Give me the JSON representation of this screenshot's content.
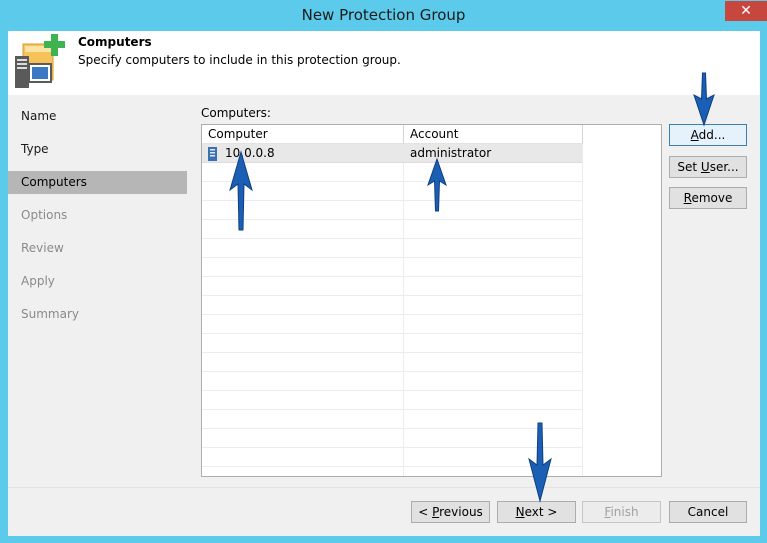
{
  "window": {
    "title": "New Protection Group",
    "close_symbol": "✕"
  },
  "header": {
    "title": "Computers",
    "subtitle": "Specify computers to include in this protection group.",
    "icon": "computers-add-icon"
  },
  "nav": {
    "items": [
      {
        "label": "Name",
        "state": "done"
      },
      {
        "label": "Type",
        "state": "done"
      },
      {
        "label": "Computers",
        "state": "active"
      },
      {
        "label": "Options",
        "state": "disabled"
      },
      {
        "label": "Review",
        "state": "disabled"
      },
      {
        "label": "Apply",
        "state": "disabled"
      },
      {
        "label": "Summary",
        "state": "disabled"
      }
    ]
  },
  "computers": {
    "label": "Computers:",
    "columns": [
      "Computer",
      "Account"
    ],
    "rows": [
      {
        "computer": "10.0.0.8",
        "account": "administrator",
        "icon": "server-icon"
      }
    ]
  },
  "side_buttons": {
    "add": {
      "pre": "",
      "key": "A",
      "post": "dd..."
    },
    "set_user": {
      "pre": "Set ",
      "key": "U",
      "post": "ser..."
    },
    "remove": {
      "pre": "",
      "key": "R",
      "post": "emove"
    }
  },
  "footer": {
    "previous": {
      "pre": "< ",
      "key": "P",
      "post": "revious"
    },
    "next": {
      "pre": "",
      "key": "N",
      "post": "ext >"
    },
    "finish": {
      "pre": "",
      "key": "F",
      "post": "inish"
    },
    "cancel": "Cancel"
  },
  "colors": {
    "frame": "#5ccbeb",
    "arrow": "#1a5fb4",
    "active_nav": "#b6b6b6",
    "close": "#c7463d"
  }
}
